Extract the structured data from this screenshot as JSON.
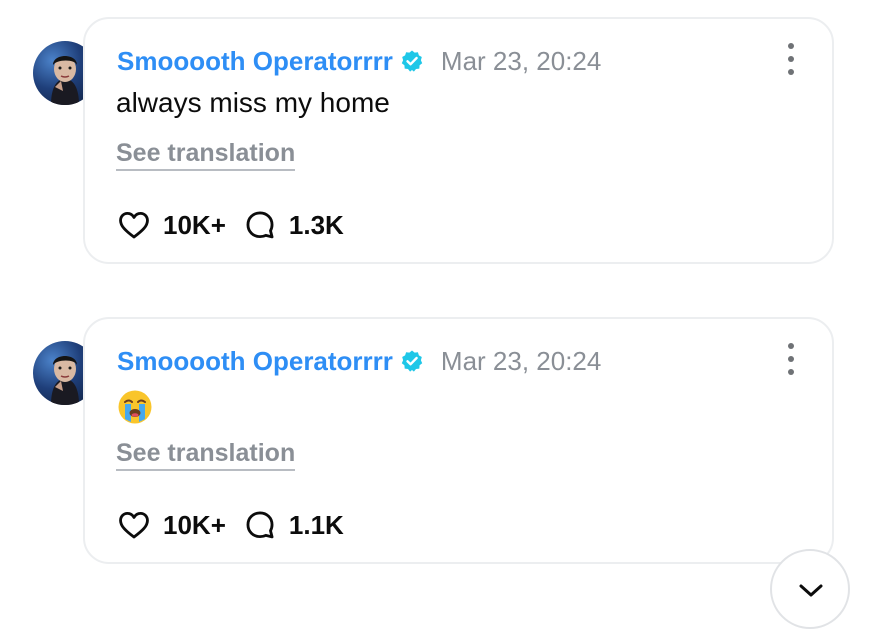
{
  "posts": [
    {
      "author": "Smooooth Operatorrrr",
      "timestamp": "Mar 23, 20:24",
      "text": "always miss my home",
      "emoji": "",
      "translate_label": "See translation",
      "likes": "10K+",
      "comments": "1.3K"
    },
    {
      "author": "Smooooth Operatorrrr",
      "timestamp": "Mar 23, 20:24",
      "text": "",
      "emoji": "loudly-crying-face",
      "translate_label": "See translation",
      "likes": "10K+",
      "comments": "1.1K"
    }
  ],
  "icons": {
    "verified": "verified-badge-icon",
    "more": "more-vertical-icon",
    "like": "heart-icon",
    "comment": "comment-bubble-icon",
    "scroll": "chevron-down-icon"
  },
  "colors": {
    "author": "#2e8ef5",
    "verified": "#1fc7e8",
    "muted": "#8a8f96",
    "border": "#eceef0"
  }
}
